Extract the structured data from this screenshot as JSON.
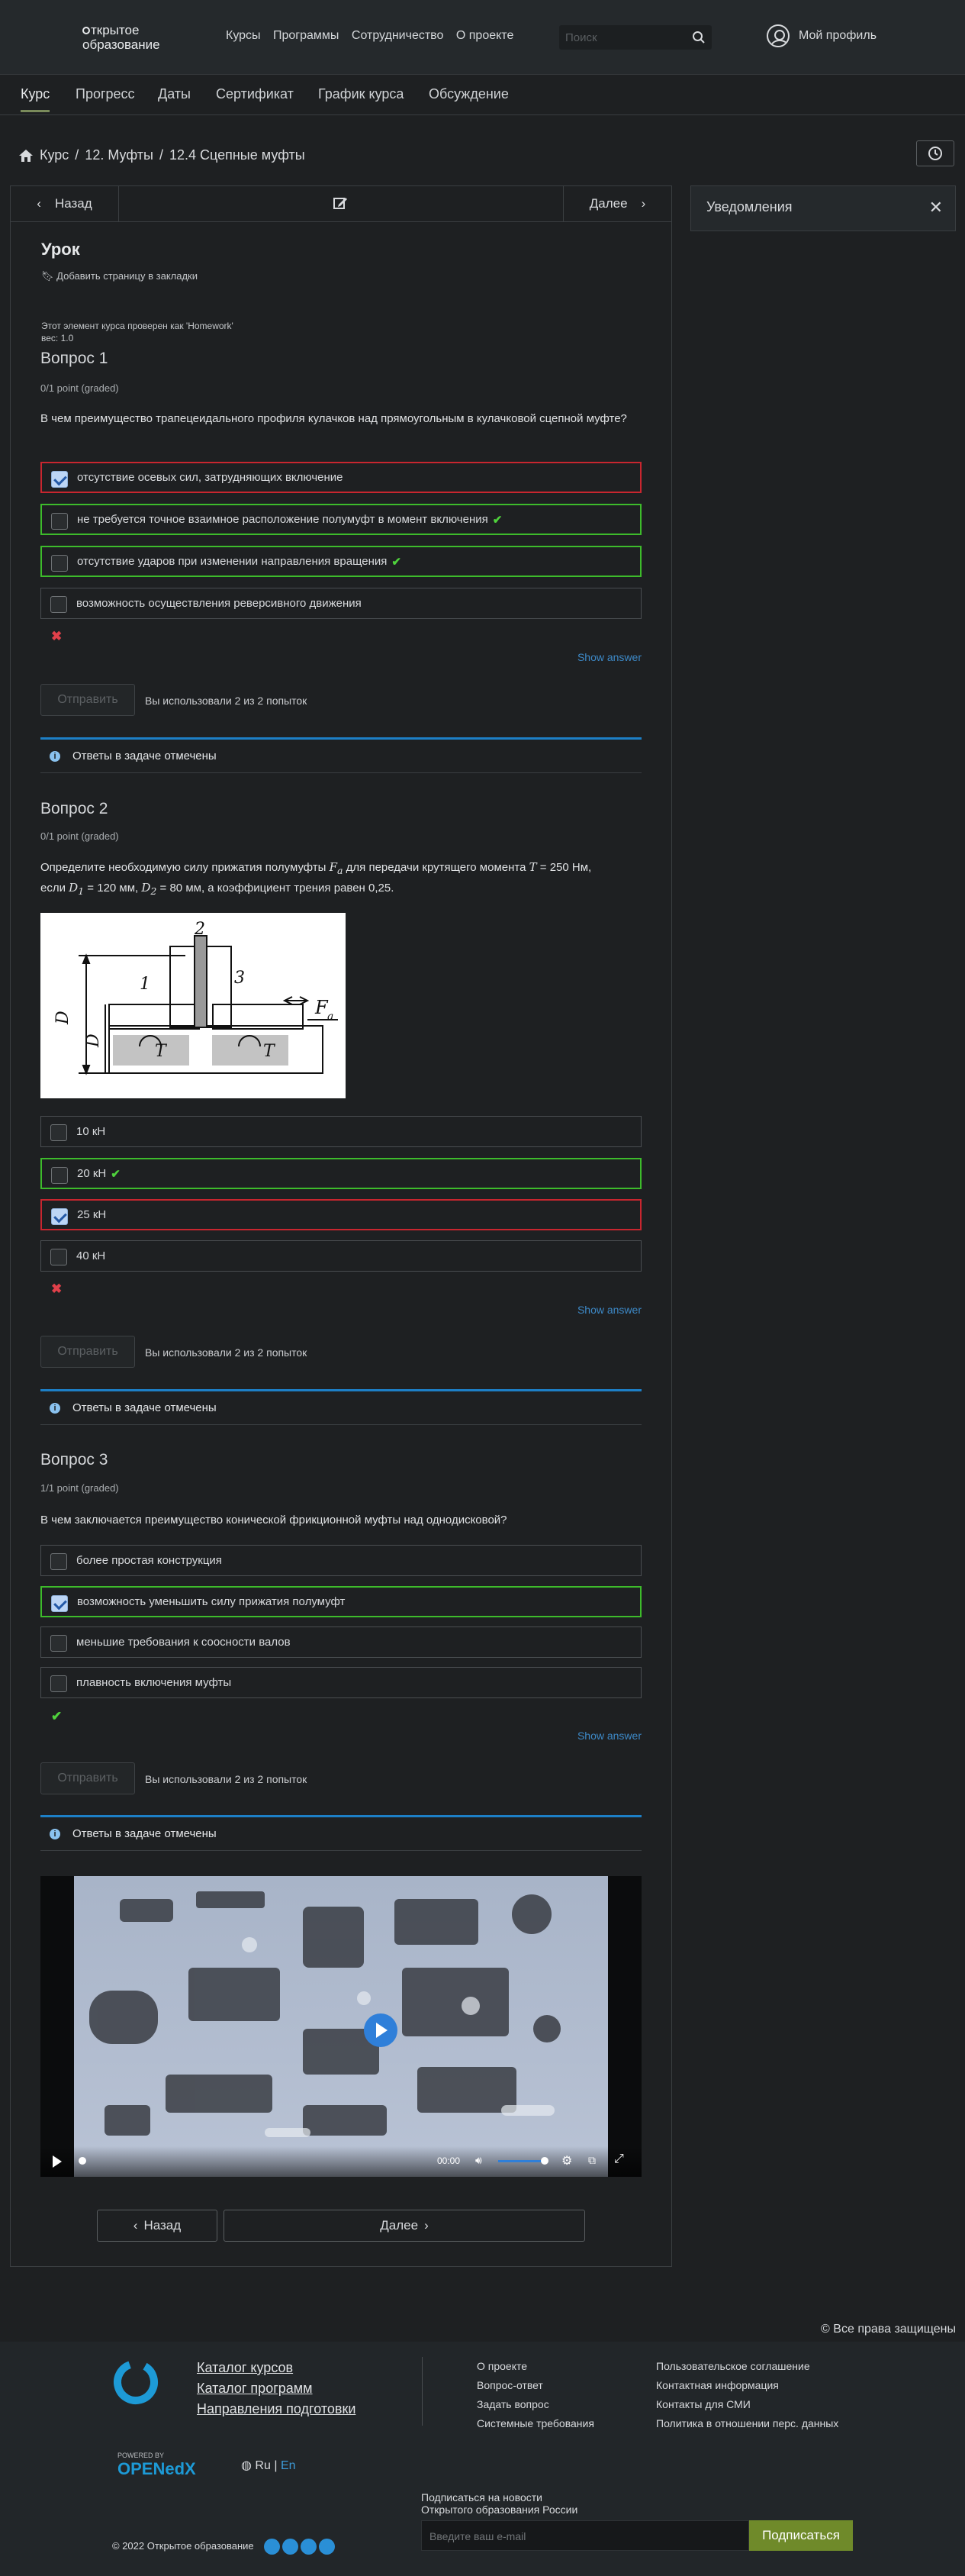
{
  "header": {
    "logo_line1": "ткрытое",
    "logo_line2": "образование",
    "nav": [
      "Курсы",
      "Программы",
      "Сотрудничество",
      "О проекте"
    ],
    "search_placeholder": "Поиск",
    "profile": "Мой профиль"
  },
  "course_tabs": [
    "Курс",
    "Прогресс",
    "Даты",
    "Сертификат",
    "График курса",
    "Обсуждение"
  ],
  "breadcrumb": [
    "Курс",
    "12. Муфты",
    "12.4 Сцепные муфты"
  ],
  "sequence": {
    "prev": "Назад",
    "next": "Далее"
  },
  "sidebar": {
    "title": "Уведомления"
  },
  "lesson": {
    "title": "Урок",
    "bookmark": "Добавить страницу в закладки",
    "checked_note": "Этот элемент курса проверен как 'Homework'",
    "weight": "вес: 1.0"
  },
  "questions": [
    {
      "title": "Вопрос 1",
      "points": "0/1 point (graded)",
      "text": "В чем преимущество трапецеидального профиля кулачков над прямоугольным в кулачковой сцепной муфте?",
      "options": [
        {
          "label": "отсутствие осевых сил, затрудняющих включение",
          "checked": true,
          "state": "wrong"
        },
        {
          "label": "не требуется точное взаимное расположение полумуфт в момент включения",
          "checked": false,
          "state": "correct"
        },
        {
          "label": "отсутствие ударов при изменении направления вращения",
          "checked": false,
          "state": "correct"
        },
        {
          "label": "возможность осуществления реверсивного движения",
          "checked": false,
          "state": "none"
        }
      ],
      "result": "wrong"
    },
    {
      "title": "Вопрос 2",
      "points": "0/1 point (graded)",
      "text_a": "Определите необходимую силу прижатия полумуфты ",
      "text_b": " для передачи крутящего момента ",
      "text_c": " = 250 Нм,",
      "text_d": "если ",
      "text_e": " = 120 мм, ",
      "text_f": " = 80 мм, а коэффициент трения равен 0,25.",
      "options": [
        {
          "label": "10 кН",
          "checked": false,
          "state": "none"
        },
        {
          "label": "20 кН",
          "checked": false,
          "state": "correct"
        },
        {
          "label": "25 кН",
          "checked": true,
          "state": "wrong"
        },
        {
          "label": "40 кН",
          "checked": false,
          "state": "none"
        }
      ],
      "result": "wrong"
    },
    {
      "title": "Вопрос 3",
      "points": "1/1 point (graded)",
      "text": "В чем заключается преимущество конической фрикционной муфты над однодисковой?",
      "options": [
        {
          "label": "более простая конструкция",
          "checked": false,
          "state": "none"
        },
        {
          "label": "возможность уменьшить силу прижатия полумуфт",
          "checked": true,
          "state": "correct"
        },
        {
          "label": "меньшие требования к соосности валов",
          "checked": false,
          "state": "none"
        },
        {
          "label": "плавность включения муфты",
          "checked": false,
          "state": "none"
        }
      ],
      "result": "correct"
    }
  ],
  "show_answer": "Show answer",
  "submit": "Отправить",
  "attempts": "Вы использовали 2 из 2 попыток",
  "notice": "Ответы в задаче отмечены",
  "figure_labels": {
    "D1": "D",
    "D1_sub": "1",
    "D2": "D",
    "D2_sub": "2",
    "n1": "1",
    "n2": "2",
    "n3": "3",
    "T": "T",
    "Fa": "F",
    "Fa_sub": "a"
  },
  "video": {
    "time": "00:00"
  },
  "bottom_nav": {
    "prev": "Назад",
    "next": "Далее"
  },
  "footer": {
    "rights": "Все права защищены",
    "links": [
      "Каталог курсов",
      "Каталог программ",
      "Направления подготовки"
    ],
    "col1": [
      "О проекте",
      "Вопрос-ответ",
      "Задать вопрос",
      "Системные требования"
    ],
    "col2": [
      "Пользовательское соглашение",
      "Контактная информация",
      "Контакты для СМИ",
      "Политика в отношении перс. данных"
    ],
    "powered": "POWERED BY",
    "openedx": "OPENedX",
    "lang_ru": "Ru",
    "lang_sep": "|",
    "lang_en": "En",
    "newsletter_1": "Подписаться на новости",
    "newsletter_2": "Открытого образования России",
    "email_placeholder": "Введите ваш e-mail",
    "subscribe": "Подписаться",
    "copyright": "© 2022 Открытое образование"
  }
}
